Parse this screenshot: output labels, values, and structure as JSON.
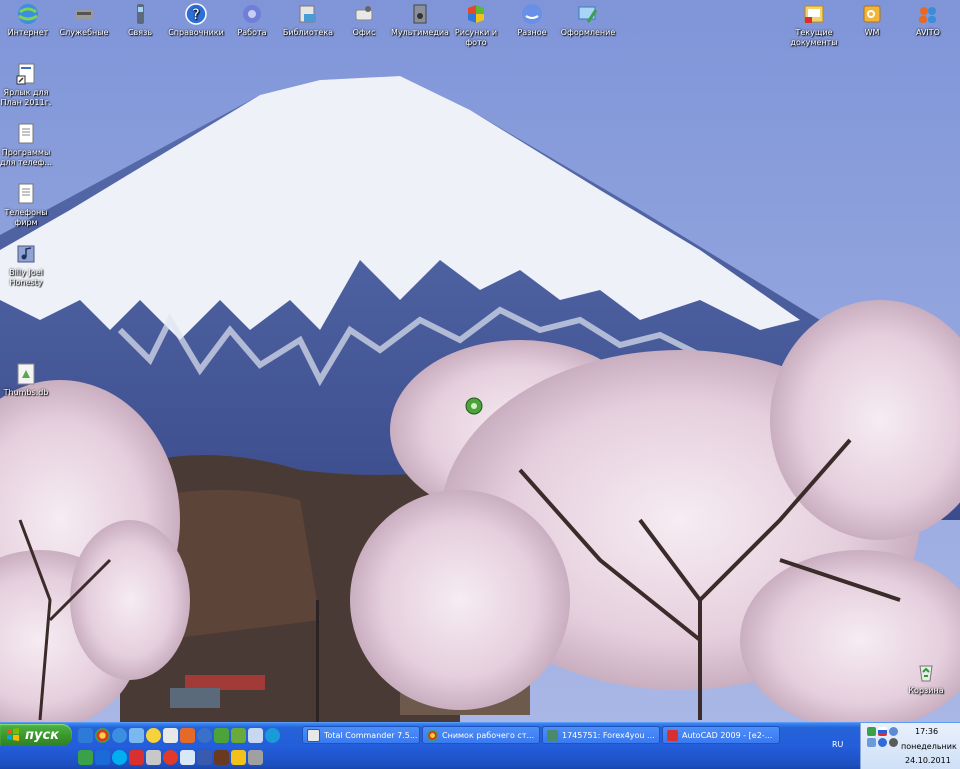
{
  "desktop": {
    "top_icons": [
      {
        "label": "Интернет",
        "icon": "internet-icon"
      },
      {
        "label": "Служебные",
        "icon": "utilities-icon"
      },
      {
        "label": "Связь",
        "icon": "phone-icon"
      },
      {
        "label": "Справочники",
        "icon": "help-icon"
      },
      {
        "label": "Работа",
        "icon": "gear-icon"
      },
      {
        "label": "Библиотека",
        "icon": "library-icon"
      },
      {
        "label": "Офис",
        "icon": "office-icon"
      },
      {
        "label": "Мультимедиа",
        "icon": "multimedia-icon"
      },
      {
        "label": "Рисунки и фото",
        "icon": "pictures-icon"
      },
      {
        "label": "Разное",
        "icon": "misc-icon"
      },
      {
        "label": "Оформление",
        "icon": "appearance-icon"
      }
    ],
    "right_icons": [
      {
        "label": "Текущие документы",
        "icon": "documents-icon"
      },
      {
        "label": "WM",
        "icon": "wm-icon"
      },
      {
        "label": "AVITO",
        "icon": "users-icon"
      }
    ],
    "left_icons": [
      {
        "label": "Ярлык для План 2011г.",
        "icon": "shortcut-icon"
      },
      {
        "label": "Программы для телеф...",
        "icon": "text-file-icon"
      },
      {
        "label": "Телефоны фирм",
        "icon": "text-file-icon"
      },
      {
        "label": "Billy Joel Honesty",
        "icon": "audio-file-icon"
      },
      {
        "label": "Thumbs.db",
        "icon": "thumbs-db-icon"
      }
    ],
    "recycle_bin": {
      "label": "Корзина",
      "icon": "recycle-bin-icon"
    }
  },
  "taskbar": {
    "start_label": "пуск",
    "tasks": [
      {
        "label": "Total Commander 7.5...",
        "icon": "total-commander-icon"
      },
      {
        "label": "Снимок рабочего ст...",
        "icon": "chrome-icon"
      },
      {
        "label": "1745751: Forex4you ...",
        "icon": "forex-icon"
      },
      {
        "label": "AutoCAD 2009 - [e2-...",
        "icon": "autocad-icon"
      }
    ],
    "language": "RU",
    "clock": {
      "time": "17:36",
      "day": "понедельник",
      "date": "24.10.2011"
    }
  },
  "colors": {
    "taskbar": "#245edb",
    "start_button": "#3c9a2d",
    "tray": "#d8e6f8"
  }
}
